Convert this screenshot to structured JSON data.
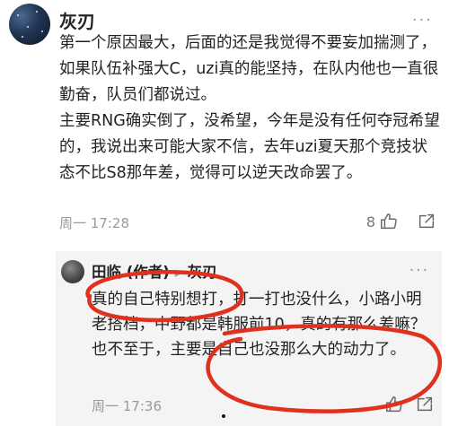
{
  "comment": {
    "username": "灰刃",
    "more_label": "···",
    "paragraphs": [
      "第一个原因最大，后面的还是我觉得不要妄加揣测了，如果队伍补强大C，uzi真的能坚持，在队内他也一直很勤奋，队员们都说过。",
      "主要RNG确实倒了，没希望，今年是没有任何夺冠希望的，我说出来可能大家不信，去年uzi夏天那个竞技状态不比S8那年差，觉得可以逆天改命罢了。"
    ],
    "timestamp": "周一 17:28",
    "like_count": "8",
    "icons": [
      "avatar",
      "more-icon",
      "thumbs-up-icon",
      "share-icon"
    ]
  },
  "reply": {
    "author": "田临",
    "author_tag": "(作者)",
    "reply_to": "灰刃",
    "more_label": "···",
    "text": "真的自己特别想打，打一打也没什么，小路小明老搭档，中野都是韩服前10，真的有那么差嘛？也不至于，主要是自己也没那么大的动力了。",
    "timestamp": "周一 17:36",
    "icons": [
      "avatar",
      "more-icon",
      "thumbs-up-icon",
      "share-icon"
    ]
  },
  "annotation_color": "#e0301e"
}
